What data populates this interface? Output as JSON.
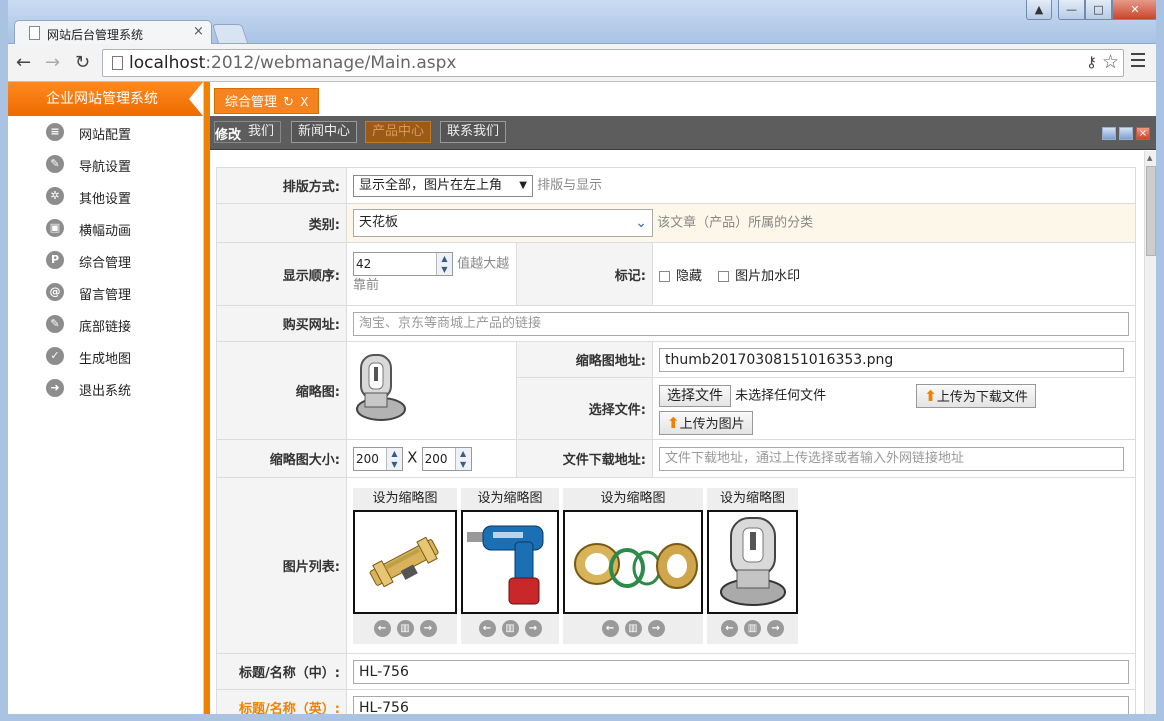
{
  "browser": {
    "tab_title": "网站后台管理系统",
    "tab_close": "×",
    "url_host": "localhost",
    "url_rest": ":2012/webmanage/Main.aspx",
    "win_user": "▲",
    "win_min": "—",
    "win_max": "□",
    "win_close": "✕"
  },
  "sidebar": {
    "title": "企业网站管理系统",
    "items": [
      {
        "label": "网站配置",
        "icon": "≡"
      },
      {
        "label": "导航设置",
        "icon": "✎"
      },
      {
        "label": "其他设置",
        "icon": "✲"
      },
      {
        "label": "横幅动画",
        "icon": "▣"
      },
      {
        "label": "综合管理",
        "icon": "P"
      },
      {
        "label": "留言管理",
        "icon": "@"
      },
      {
        "label": "底部链接",
        "icon": "✎"
      },
      {
        "label": "生成地图",
        "icon": "✓"
      },
      {
        "label": "退出系统",
        "icon": "➜"
      }
    ]
  },
  "content_tab": {
    "label": "综合管理",
    "refresh": "↻",
    "close": "X"
  },
  "inner_head": {
    "title": "修改",
    "tabs": [
      "我们",
      "新闻中心",
      "产品中心",
      "联系我们"
    ],
    "close": "×"
  },
  "form": {
    "layout_label": "排版方式:",
    "layout_value": "显示全部，图片在左上角",
    "layout_arrow": "▼",
    "layout_hint": "排版与显示",
    "category_label": "类别:",
    "category_value": "天花板",
    "category_arrow": "⌄",
    "category_hint": "该文章（产品）所属的分类",
    "order_label": "显示顺序:",
    "order_value": "42",
    "order_hint": "值越大越靠前",
    "mark_label": "标记:",
    "mark_hidden": "隐藏",
    "mark_watermark": "图片加水印",
    "buy_label": "购买网址:",
    "buy_placeholder": "淘宝、京东等商城上产品的链接",
    "thumb_label": "缩略图:",
    "thumb_url_label": "缩略图地址:",
    "thumb_url_value": "thumb20170308151016353.png",
    "choose_label": "选择文件:",
    "choose_btn": "选择文件",
    "no_file": "未选择任何文件",
    "upload_download_btn": "上传为下载文件",
    "upload_image_btn": "上传为图片",
    "thumb_size_label": "缩略图大小:",
    "thumb_w": "200",
    "thumb_x": "X",
    "thumb_h": "200",
    "download_label": "文件下载地址:",
    "download_placeholder": "文件下载地址，通过上传选择或者输入外网链接地址",
    "image_list_label": "图片列表:",
    "set_thumb": "设为缩略图",
    "title_cn_label": "标题/名称（中）:",
    "title_cn_value": "HL-756",
    "title_en_label": "标题/名称（英）:",
    "title_en_value": "HL-756"
  },
  "colors": {
    "accent": "#f08200",
    "header_bg": "#5d5d5d",
    "chrome": "#aac3e3"
  }
}
